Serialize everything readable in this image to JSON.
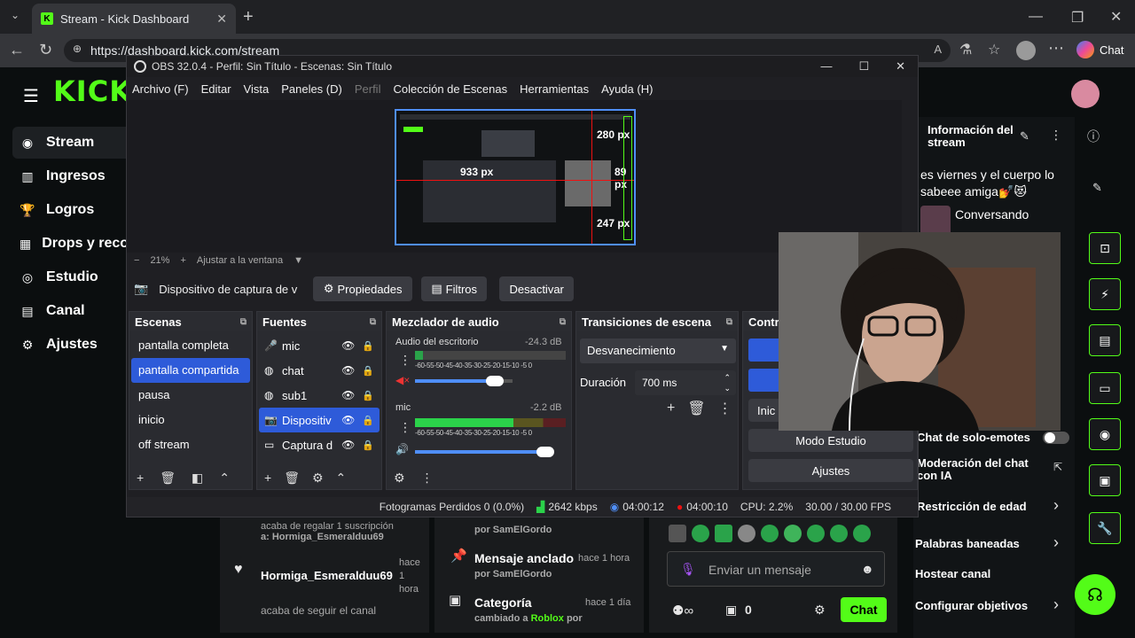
{
  "browser": {
    "tab_title": "Stream - Kick Dashboard",
    "url": "https://dashboard.kick.com/stream",
    "copilot_label": "Chat"
  },
  "kick": {
    "logo": "KICK",
    "nav": [
      {
        "icon": "stream-icon",
        "label": "Stream"
      },
      {
        "icon": "income-icon",
        "label": "Ingresos"
      },
      {
        "icon": "achievements-icon",
        "label": "Logros"
      },
      {
        "icon": "drops-icon",
        "label": "Drops y reco"
      },
      {
        "icon": "studio-icon",
        "label": "Estudio"
      },
      {
        "icon": "channel-icon",
        "label": "Canal"
      },
      {
        "icon": "settings-icon",
        "label": "Ajustes"
      }
    ],
    "stream_info": {
      "heading": "Información del stream",
      "title": "es viernes y el cuerpo lo sabeee amiga💅😻",
      "category": "Conversando"
    },
    "settings_list": [
      {
        "label": "Chat de solo-emotes"
      },
      {
        "label": "Moderación del chat con IA"
      },
      {
        "label": "Restricción de edad"
      },
      {
        "label": "Palabras baneadas"
      },
      {
        "label": "Hostear canal"
      },
      {
        "label": "Configurar objetivos"
      }
    ],
    "activity": {
      "item1_line": "acaba de regalar 1 suscripción",
      "item1_user": "a: Hormiga_Esmeralduu69",
      "item2_user": "Hormiga_Esmeralduu69",
      "item2_time": "hace 1 hora",
      "item2_text": "acaba de seguir el canal"
    },
    "events": {
      "by1": "por SamElGordo",
      "pinned_title": "Mensaje anclado",
      "pinned_time": "hace 1 hora",
      "pinned_by": "por SamElGordo",
      "category_title": "Categoría",
      "category_time": "hace 1 día",
      "category_text_prefix": "cambiado a",
      "category_game": "Roblox",
      "category_by": "por"
    },
    "chat": {
      "placeholder": "Enviar un mensaje",
      "count": "0",
      "send": "Chat"
    }
  },
  "obs": {
    "title": "OBS 32.0.4 - Perfil: Sin Título - Escenas: Sin Título",
    "menu": [
      "Archivo (F)",
      "Editar",
      "Vista",
      "Paneles (D)",
      "Perfil",
      "Colección de Escenas",
      "Herramientas",
      "Ayuda (H)"
    ],
    "preview_labels": {
      "a": "280 px",
      "b": "933 px",
      "c": "89 px",
      "d": "247 px"
    },
    "zoom": "21%",
    "fit": "Ajustar a la ventana",
    "source_bar": {
      "source": "Dispositivo de captura de v",
      "props": "Propiedades",
      "filters": "Filtros",
      "deactivate": "Desactivar"
    },
    "scenes_title": "Escenas",
    "scenes": [
      "pantalla completa",
      "pantalla compartida",
      "pausa",
      "inicio",
      "off stream"
    ],
    "sources_title": "Fuentes",
    "sources": [
      {
        "label": "mic",
        "icon": "mic-icon"
      },
      {
        "label": "chat",
        "icon": "browser-icon"
      },
      {
        "label": "sub1",
        "icon": "browser-icon"
      },
      {
        "label": "Dispositiv",
        "icon": "camera-icon"
      },
      {
        "label": "Captura d",
        "icon": "monitor-icon"
      }
    ],
    "mixer_title": "Mezclador de audio",
    "mixer": [
      {
        "name": "Audio del escritorio",
        "db": "-24.3 dB",
        "level": 0.05,
        "volume": 0.82
      },
      {
        "name": "mic",
        "db": "-2.2 dB",
        "level": 0.65,
        "volume": 0.98
      }
    ],
    "meter_ticks": "-60-55-50-45-40-35-30-25-20-15-10 -5  0",
    "transitions_title": "Transiciones de escena",
    "transition": "Desvanecimiento",
    "duration_label": "Duración",
    "duration": "700 ms",
    "controls_title": "Contr",
    "controls": {
      "start": "Inic",
      "studio": "Modo Estudio",
      "settings": "Ajustes"
    },
    "status": {
      "dropped": "Fotogramas Perdidos 0 (0.0%)",
      "bitrate": "2642 kbps",
      "stream_time": "04:00:12",
      "rec_time": "04:00:10",
      "cpu": "CPU: 2.2%",
      "fps": "30.00 / 30.00 FPS"
    }
  }
}
